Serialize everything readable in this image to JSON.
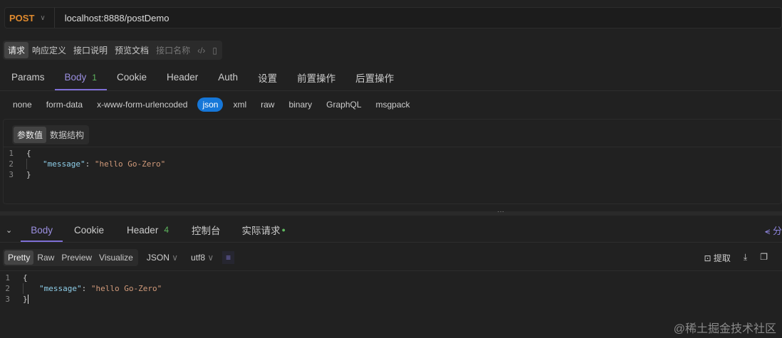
{
  "request": {
    "method": "POST",
    "url": "localhost:8888/postDemo"
  },
  "mode_tabs": [
    {
      "label": "请求",
      "active": true
    },
    {
      "label": "响应定义"
    },
    {
      "label": "接口说明"
    },
    {
      "label": "预览文档"
    }
  ],
  "api_name_placeholder": "接口名称",
  "req_tabs": [
    {
      "label": "Params"
    },
    {
      "label": "Body",
      "badge": "1",
      "active": true
    },
    {
      "label": "Cookie"
    },
    {
      "label": "Header"
    },
    {
      "label": "Auth"
    },
    {
      "label": "设置"
    },
    {
      "label": "前置操作"
    },
    {
      "label": "后置操作"
    }
  ],
  "body_types": [
    {
      "label": "none"
    },
    {
      "label": "form-data"
    },
    {
      "label": "x-www-form-urlencoded"
    },
    {
      "label": "json",
      "active": true
    },
    {
      "label": "xml"
    },
    {
      "label": "raw"
    },
    {
      "label": "binary"
    },
    {
      "label": "GraphQL"
    },
    {
      "label": "msgpack"
    }
  ],
  "value_tabs": [
    {
      "label": "参数值",
      "active": true
    },
    {
      "label": "数据结构"
    }
  ],
  "request_body": {
    "lines": [
      "1",
      "2",
      "3"
    ],
    "open": "{",
    "key": "\"message\"",
    "colon": ": ",
    "value": "\"hello Go-Zero\"",
    "close": "}"
  },
  "resp_tabs": [
    {
      "label": "Body",
      "active": true
    },
    {
      "label": "Cookie"
    },
    {
      "label": "Header",
      "badge": "4"
    },
    {
      "label": "控制台"
    },
    {
      "label": "实际请求",
      "dot": true
    }
  ],
  "share_label": "分",
  "view_tabs": [
    {
      "label": "Pretty",
      "active": true
    },
    {
      "label": "Raw"
    },
    {
      "label": "Preview"
    },
    {
      "label": "Visualize"
    }
  ],
  "format": "JSON",
  "encoding": "utf8",
  "extract_label": "提取",
  "response_body": {
    "lines": [
      "1",
      "2",
      "3"
    ],
    "open": "{",
    "key": "\"message\"",
    "colon": ": ",
    "value": "\"hello Go-Zero\"",
    "close": "}"
  },
  "watermark": "@稀土掘金技术社区",
  "colors": {
    "accent": "#7e6fd6",
    "method": "#e08a2e",
    "json_active": "#1677d8",
    "badge": "#5fb85f"
  }
}
